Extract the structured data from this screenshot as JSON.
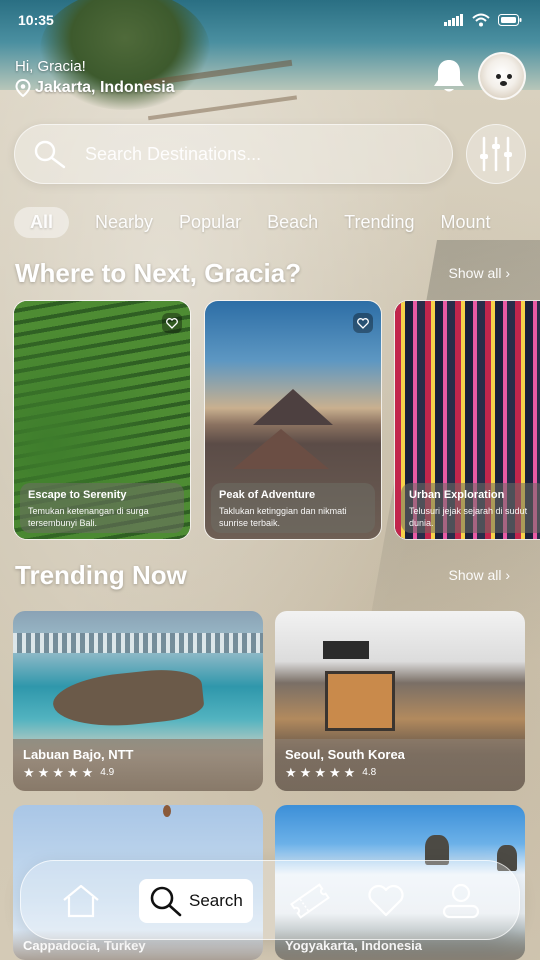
{
  "status_bar": {
    "time": "10:35"
  },
  "header": {
    "greeting": "Hi, Gracia!",
    "location": "Jakarta, Indonesia"
  },
  "search": {
    "placeholder": "Search Destinations..."
  },
  "categories": [
    {
      "label": "All",
      "active": true
    },
    {
      "label": "Nearby"
    },
    {
      "label": "Popular"
    },
    {
      "label": "Beach"
    },
    {
      "label": "Trending"
    },
    {
      "label": "Mount"
    }
  ],
  "where_next": {
    "title": "Where to Next, Gracia?",
    "show_all": "Show all ›",
    "cards": [
      {
        "title": "Escape to Serenity",
        "desc": "Temukan ketenangan di surga tersembunyi Bali."
      },
      {
        "title": "Peak of Adventure",
        "desc": "Taklukan ketinggian dan nikmati sunrise terbaik."
      },
      {
        "title": "Urban Exploration",
        "desc": "Telusuri jejak sejarah di sudut dunia."
      }
    ]
  },
  "trending": {
    "title": "Trending Now",
    "show_all": "Show all ›",
    "cards": [
      {
        "title": "Labuan Bajo, NTT",
        "rating": "4.9"
      },
      {
        "title": "Seoul, South Korea",
        "rating": "4.8"
      },
      {
        "title": "Cappadocia, Turkey",
        "rating": ""
      },
      {
        "title": "Yogyakarta, Indonesia",
        "rating": ""
      }
    ]
  },
  "nav": {
    "search_label": "Search"
  },
  "icons": {
    "location": "location-pin-icon",
    "bell": "bell-icon",
    "search": "search-icon",
    "filter": "sliders-icon",
    "heart": "heart-icon",
    "home": "home-icon",
    "ticket": "ticket-icon",
    "profile": "user-icon"
  },
  "colors": {
    "accent": "#ffffff",
    "sea": "#2a6f83",
    "sand": "#d9d1bf"
  }
}
